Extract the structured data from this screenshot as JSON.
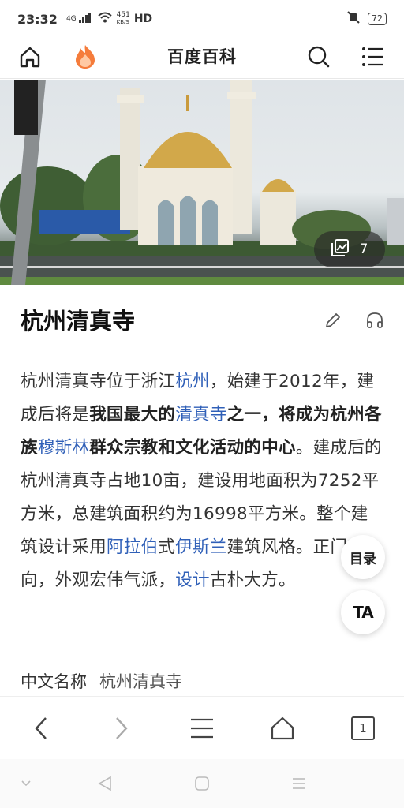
{
  "status": {
    "time": "23:32",
    "network": "4G",
    "speed_value": "451",
    "speed_unit": "KB/S",
    "hd": "HD",
    "battery": "72"
  },
  "topnav": {
    "title": "百度百科",
    "icons": [
      "home-icon",
      "flame-icon",
      "search-icon",
      "menu-icon"
    ]
  },
  "hero": {
    "photo_count": "7"
  },
  "article": {
    "title": "杭州清真寺",
    "summary": [
      {
        "t": "杭州清真寺位于浙江",
        "k": "text"
      },
      {
        "t": "杭州",
        "k": "link"
      },
      {
        "t": "，始建于2012年，建成后将是",
        "k": "text"
      },
      {
        "t": "我国最大的",
        "k": "bold"
      },
      {
        "t": "清真寺",
        "k": "link"
      },
      {
        "t": "之一，将成为杭州各族",
        "k": "bold"
      },
      {
        "t": "穆斯林",
        "k": "link"
      },
      {
        "t": "群众宗教和文化活动的中心",
        "k": "bold"
      },
      {
        "t": "。建成后的杭州清真寺占地10亩，建设用地面积为7252平方米，总建筑面积约为16998平方米。整个建筑设计采用",
        "k": "text"
      },
      {
        "t": "阿拉伯",
        "k": "link"
      },
      {
        "t": "式",
        "k": "text"
      },
      {
        "t": "伊斯兰",
        "k": "link"
      },
      {
        "t": "建筑风格。正门东向，外观宏伟气派，",
        "k": "text"
      },
      {
        "t": "设计",
        "k": "link"
      },
      {
        "t": "古朴大方。",
        "k": "text"
      }
    ],
    "info": {
      "label": "中文名称",
      "value": "杭州清真寺"
    }
  },
  "floating": {
    "toc_label": "目录",
    "ta_label": "TA"
  },
  "browser_bar": {
    "tab_count": "1"
  },
  "colors": {
    "link": "#3060b8",
    "accent_flame": "#f57c3b"
  }
}
